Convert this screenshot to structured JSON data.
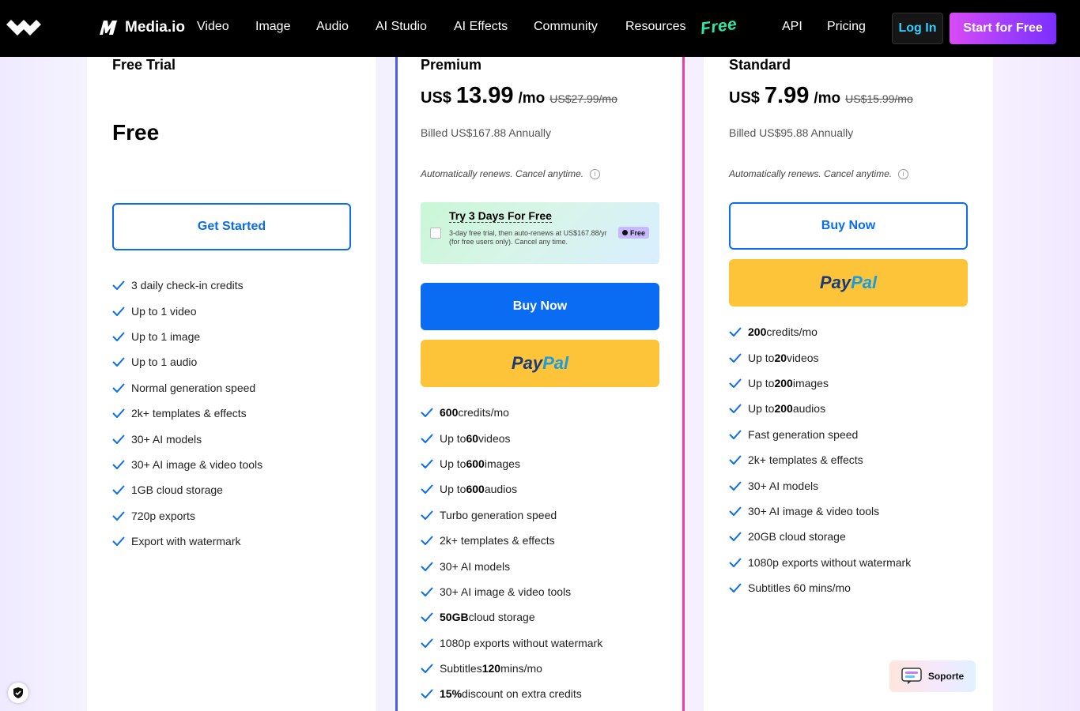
{
  "nav": {
    "brand": "Media.io",
    "links": [
      "Video",
      "Image",
      "Audio",
      "AI Studio",
      "AI Effects",
      "Community",
      "Resources"
    ],
    "free_badge": "Free",
    "api": "API",
    "pricing": "Pricing",
    "login": "Log In",
    "start": "Start for Free"
  },
  "plans": {
    "free": {
      "name": "Free Trial",
      "price": "Free",
      "cta": "Get Started",
      "features": [
        "3 daily check-in credits",
        "Up to 1 video",
        "Up to 1 image",
        "Up to 1 audio",
        "Normal generation speed",
        "2k+ templates & effects",
        "30+ AI models",
        "30+ AI image & video tools",
        "1GB cloud storage",
        "720p exports",
        "Export with watermark"
      ]
    },
    "premium": {
      "name": "Premium",
      "currency": "US$",
      "amount": "13.99",
      "period": "/mo",
      "old_price": "US$27.99/mo",
      "billed": "Billed US$167.88 Annually",
      "renew": "Automatically renews. Cancel anytime.",
      "trial_title": "Try 3 Days For Free",
      "trial_desc": "3-day free trial, then auto-renews at US$167.88/yr (for free users only). Cancel any time.",
      "trial_badge": "Free",
      "buy": "Buy Now",
      "paypal_a": "Pay",
      "paypal_b": "Pal",
      "features": [
        {
          "pre": "",
          "bold": "600",
          "post": " credits/mo"
        },
        {
          "pre": "Up to ",
          "bold": "60",
          "post": " videos"
        },
        {
          "pre": "Up to ",
          "bold": "600",
          "post": " images"
        },
        {
          "pre": "Up to ",
          "bold": "600",
          "post": " audios"
        },
        {
          "pre": "Turbo generation speed",
          "bold": "",
          "post": ""
        },
        {
          "pre": "2k+ templates & effects",
          "bold": "",
          "post": ""
        },
        {
          "pre": "30+ AI models",
          "bold": "",
          "post": ""
        },
        {
          "pre": "30+ AI image & video tools",
          "bold": "",
          "post": ""
        },
        {
          "pre": "",
          "bold": "50GB",
          "post": " cloud storage"
        },
        {
          "pre": "1080p exports without watermark",
          "bold": "",
          "post": ""
        },
        {
          "pre": "Subtitles ",
          "bold": "120",
          "post": " mins/mo"
        },
        {
          "pre": "",
          "bold": "15%",
          "post": " discount on extra credits"
        }
      ]
    },
    "standard": {
      "name": "Standard",
      "currency": "US$",
      "amount": "7.99",
      "period": "/mo",
      "old_price": "US$15.99/mo",
      "billed": "Billed US$95.88 Annually",
      "renew": "Automatically renews. Cancel anytime.",
      "buy": "Buy Now",
      "paypal_a": "Pay",
      "paypal_b": "Pal",
      "features": [
        {
          "pre": "",
          "bold": "200",
          "post": " credits/mo"
        },
        {
          "pre": "Up to ",
          "bold": "20",
          "post": " videos"
        },
        {
          "pre": "Up to ",
          "bold": "200",
          "post": " images"
        },
        {
          "pre": "Up to ",
          "bold": "200",
          "post": " audios"
        },
        {
          "pre": "Fast generation speed",
          "bold": "",
          "post": ""
        },
        {
          "pre": "2k+ templates & effects",
          "bold": "",
          "post": ""
        },
        {
          "pre": "30+ AI models",
          "bold": "",
          "post": ""
        },
        {
          "pre": "30+ AI image & video tools",
          "bold": "",
          "post": ""
        },
        {
          "pre": "20GB cloud storage",
          "bold": "",
          "post": ""
        },
        {
          "pre": "1080p exports without watermark",
          "bold": "",
          "post": ""
        },
        {
          "pre": "Subtitles 60 mins/mo",
          "bold": "",
          "post": ""
        }
      ]
    }
  },
  "support": "Soporte",
  "colors": {
    "accent_blue": "#0a6cf2",
    "paypal_yellow": "#fdc43a",
    "premium_border_left": "#4c5cf0",
    "premium_border_right": "#ee3fa0",
    "free_badge_green": "#2ee5a8"
  }
}
